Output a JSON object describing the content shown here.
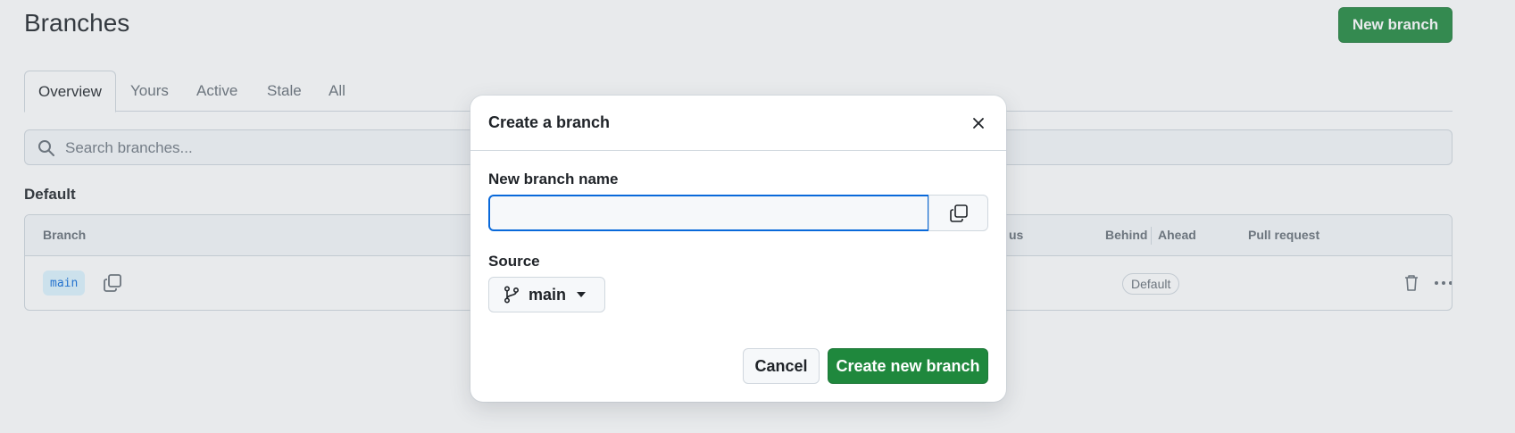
{
  "page": {
    "title": "Branches",
    "new_branch_label": "New branch",
    "tabs": [
      {
        "label": "Overview",
        "selected": true
      },
      {
        "label": "Yours",
        "selected": false
      },
      {
        "label": "Active",
        "selected": false
      },
      {
        "label": "Stale",
        "selected": false
      },
      {
        "label": "All",
        "selected": false
      }
    ],
    "search_placeholder": "Search branches...",
    "section_default": "Default",
    "table": {
      "columns": {
        "branch": "Branch",
        "status_partial": "us",
        "behind": "Behind",
        "ahead": "Ahead",
        "pull_request": "Pull request"
      },
      "rows": [
        {
          "branch": "main",
          "badge": "Default"
        }
      ]
    }
  },
  "dialog": {
    "title": "Create a branch",
    "name_label": "New branch name",
    "name_value": "",
    "source_label": "Source",
    "source_value": "main",
    "cancel_label": "Cancel",
    "create_label": "Create new branch"
  },
  "colors": {
    "primary_green": "#1f883d",
    "focus_blue": "#0969da",
    "border": "#d0d7de",
    "muted_text": "#656d76"
  }
}
